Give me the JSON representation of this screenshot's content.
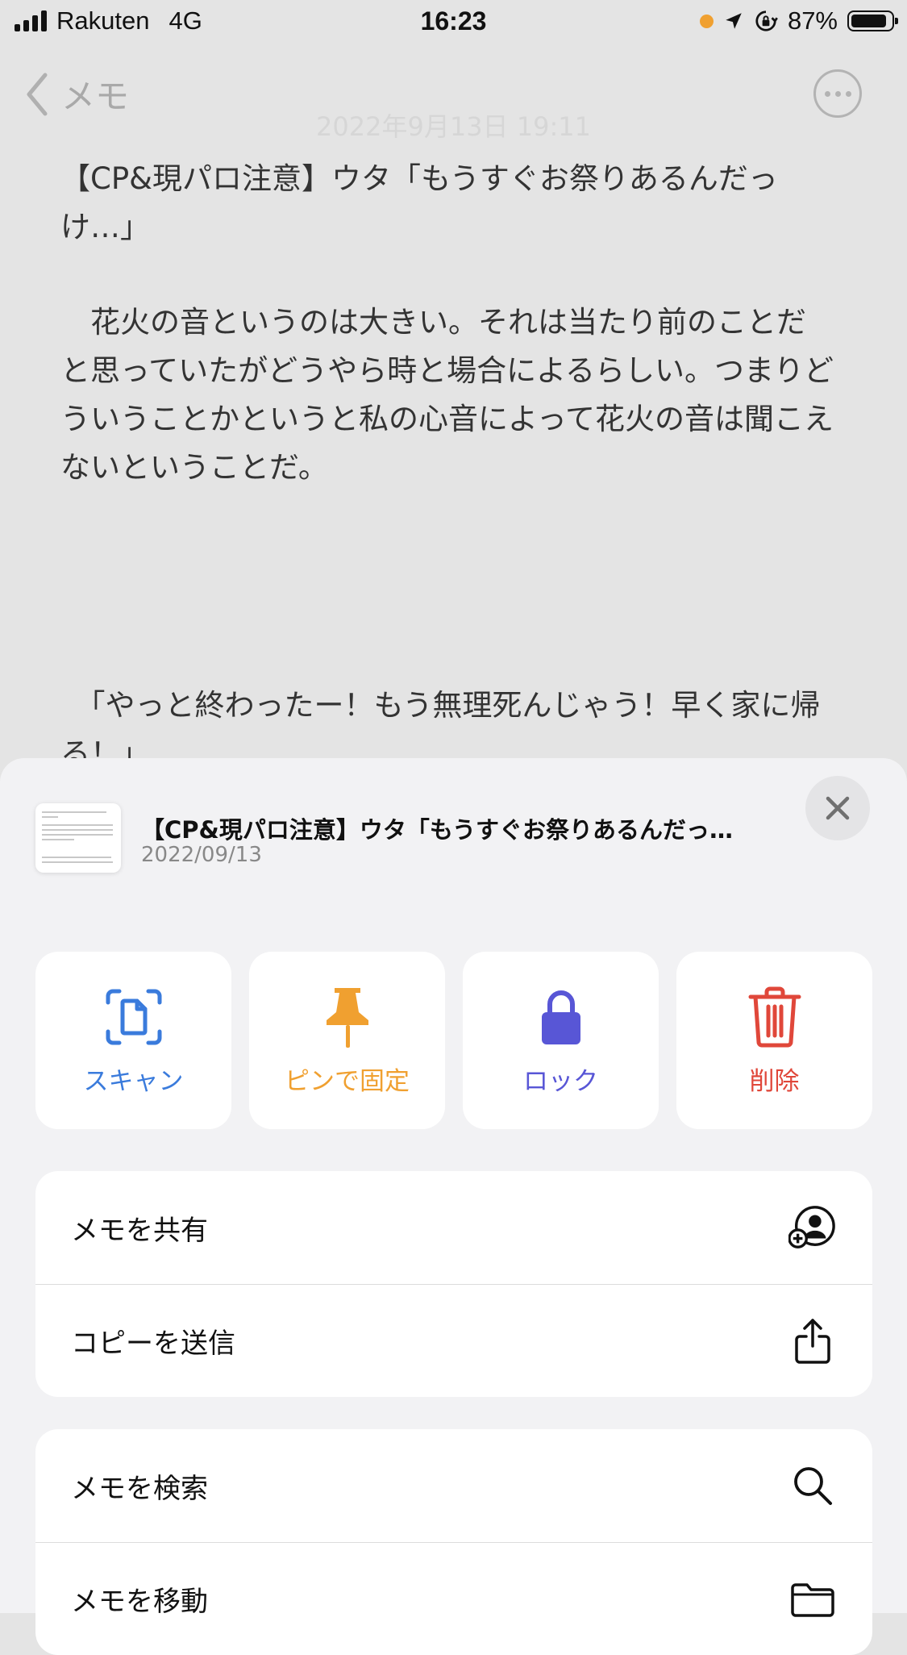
{
  "status_bar": {
    "carrier": "Rakuten",
    "network": "4G",
    "time": "16:23",
    "battery": "87%"
  },
  "nav": {
    "back_label": "メモ"
  },
  "note": {
    "date": "2022年9月13日 19:11",
    "title_line": "【CP&現パロ注意】ウタ「もうすぐお祭りあるんだっけ…」",
    "paragraph1": "　花火の音というのは大きい。それは当たり前のことだと思っていたがどうやら時と場合によるらしい。つまりどういうことかというと私の心音によって花火の音は聞こえないということだ。",
    "paragraph2": "　「やっと終わったー！もう無理死んじゃう！早く家に帰る！」"
  },
  "sheet": {
    "title": "【CP&現パロ注意】ウタ「もうすぐお祭りあるんだっ…",
    "date": "2022/09/13",
    "actions": [
      {
        "label": "スキャン",
        "icon": "scan-document-icon",
        "color": "#3a7bdc"
      },
      {
        "label": "ピンで固定",
        "icon": "pin-icon",
        "color": "#f0a030"
      },
      {
        "label": "ロック",
        "icon": "lock-icon",
        "color": "#5856d6"
      },
      {
        "label": "削除",
        "icon": "trash-icon",
        "color": "#e0473a"
      }
    ],
    "group1": [
      {
        "label": "メモを共有",
        "icon": "share-person-icon"
      },
      {
        "label": "コピーを送信",
        "icon": "share-upload-icon"
      }
    ],
    "group2": [
      {
        "label": "メモを検索",
        "icon": "search-icon"
      },
      {
        "label": "メモを移動",
        "icon": "folder-icon"
      }
    ]
  }
}
